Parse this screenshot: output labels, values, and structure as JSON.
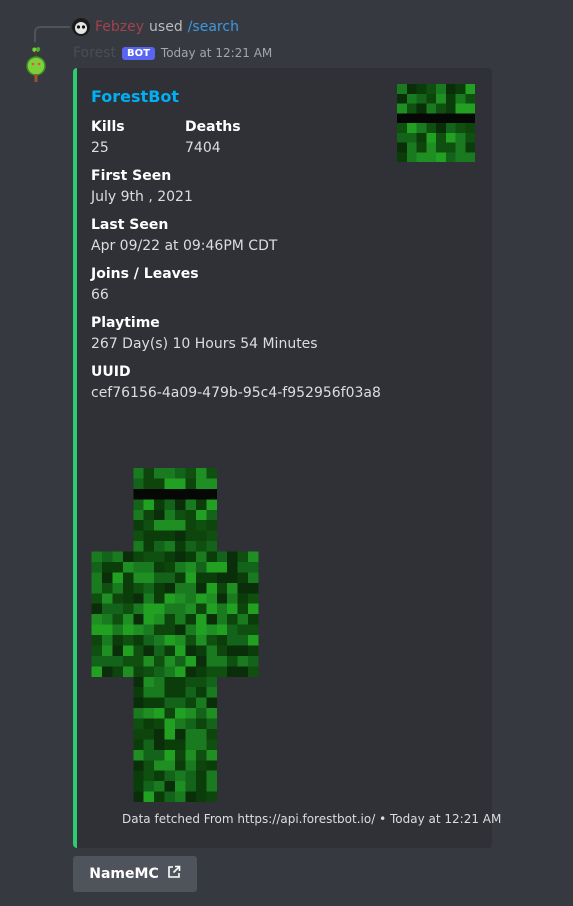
{
  "reply": {
    "username": "Febzey",
    "used_text": "used",
    "command": "/search"
  },
  "message": {
    "author": "Forest",
    "bot_badge": "BOT",
    "timestamp": "Today at 12:21 AM"
  },
  "embed": {
    "title": "ForestBot",
    "accent_color": "#2ecc71",
    "fields": {
      "kills_label": "Kills",
      "kills_value": "25",
      "deaths_label": "Deaths",
      "deaths_value": "7404",
      "first_seen_label": "First Seen",
      "first_seen_value": "July 9th , 2021",
      "last_seen_label": "Last Seen",
      "last_seen_value": "Apr 09/22 at 09:46PM CDT",
      "joins_label": "Joins / Leaves",
      "joins_value": "66",
      "playtime_label": "Playtime",
      "playtime_value": "267 Day(s) 10 Hours 54 Minutes",
      "uuid_label": "UUID",
      "uuid_value": "cef76156-4a09-479b-95c4-f952956f03a8"
    },
    "footer": {
      "source": "Data fetched From https://api.forestbot.io/",
      "separator": "•",
      "timestamp": "Today at 12:21 AM"
    }
  },
  "button": {
    "label": "NameMC"
  }
}
